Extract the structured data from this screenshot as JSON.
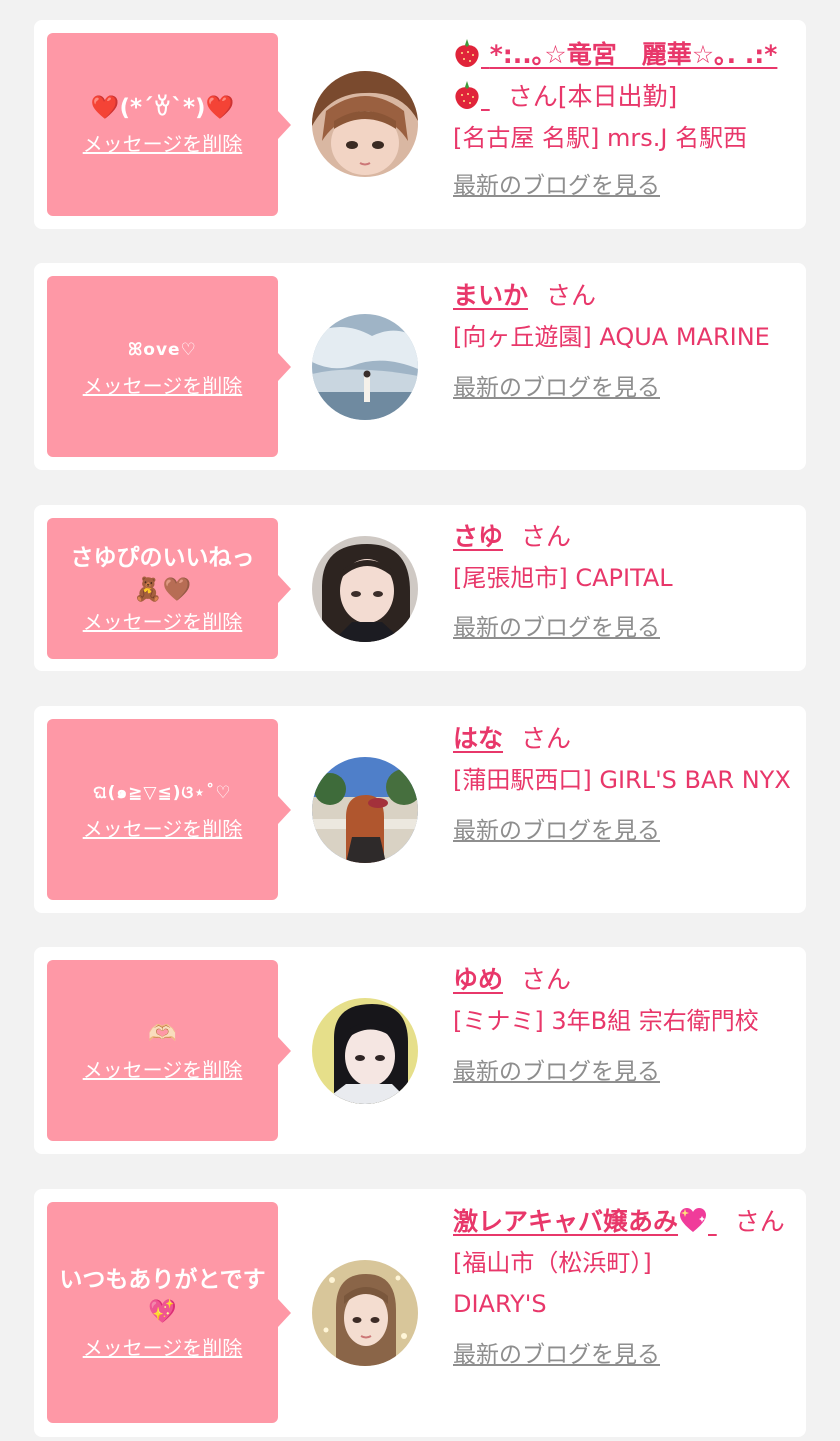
{
  "common": {
    "delete_label": "メッセージを削除",
    "blog_label": "最新のブログを見る",
    "honorific": "さん"
  },
  "entries": [
    {
      "bubble": "❤️(*´ꈊ`*)❤️",
      "name_mid": "*:..｡☆竜宮　麗華☆｡. .:*",
      "name_icons": [
        "strawberry-icon",
        "strawberry-icon"
      ],
      "status": "[本日出勤]",
      "shop": "[名古屋 名駅] mrs.J 名駅西"
    },
    {
      "bubble": "ꕤove♡",
      "name": "まいか",
      "shop": "[向ヶ丘遊園] AQUA MARINE"
    },
    {
      "bubble": "さゆぴのいいねっ🧸🤎",
      "name": "さゆ",
      "shop": "[尾張旭市] CAPITAL"
    },
    {
      "bubble": "ଘ(๑≧▽≦)ଓ⋆˚♡",
      "name": "はな",
      "shop": "[蒲田駅西口] GIRL'S BAR NYX"
    },
    {
      "bubble": "🫶🏻",
      "name": "ゆめ",
      "shop": "[ミナミ] 3年B組 宗右衛門校"
    },
    {
      "bubble": "いつもありがとです💖",
      "name_text": "激レアキャバ嬢あみ",
      "name_icon": "sparkling-heart-icon",
      "shop_area": "[福山市（松浜町）]",
      "shop_name": "DIARY'S"
    }
  ],
  "colors": {
    "accent": "#e8376a",
    "bubble": "#fe98a6",
    "link_gray": "#8e8e8e",
    "background": "#f2f2f2",
    "card": "#ffffff"
  }
}
